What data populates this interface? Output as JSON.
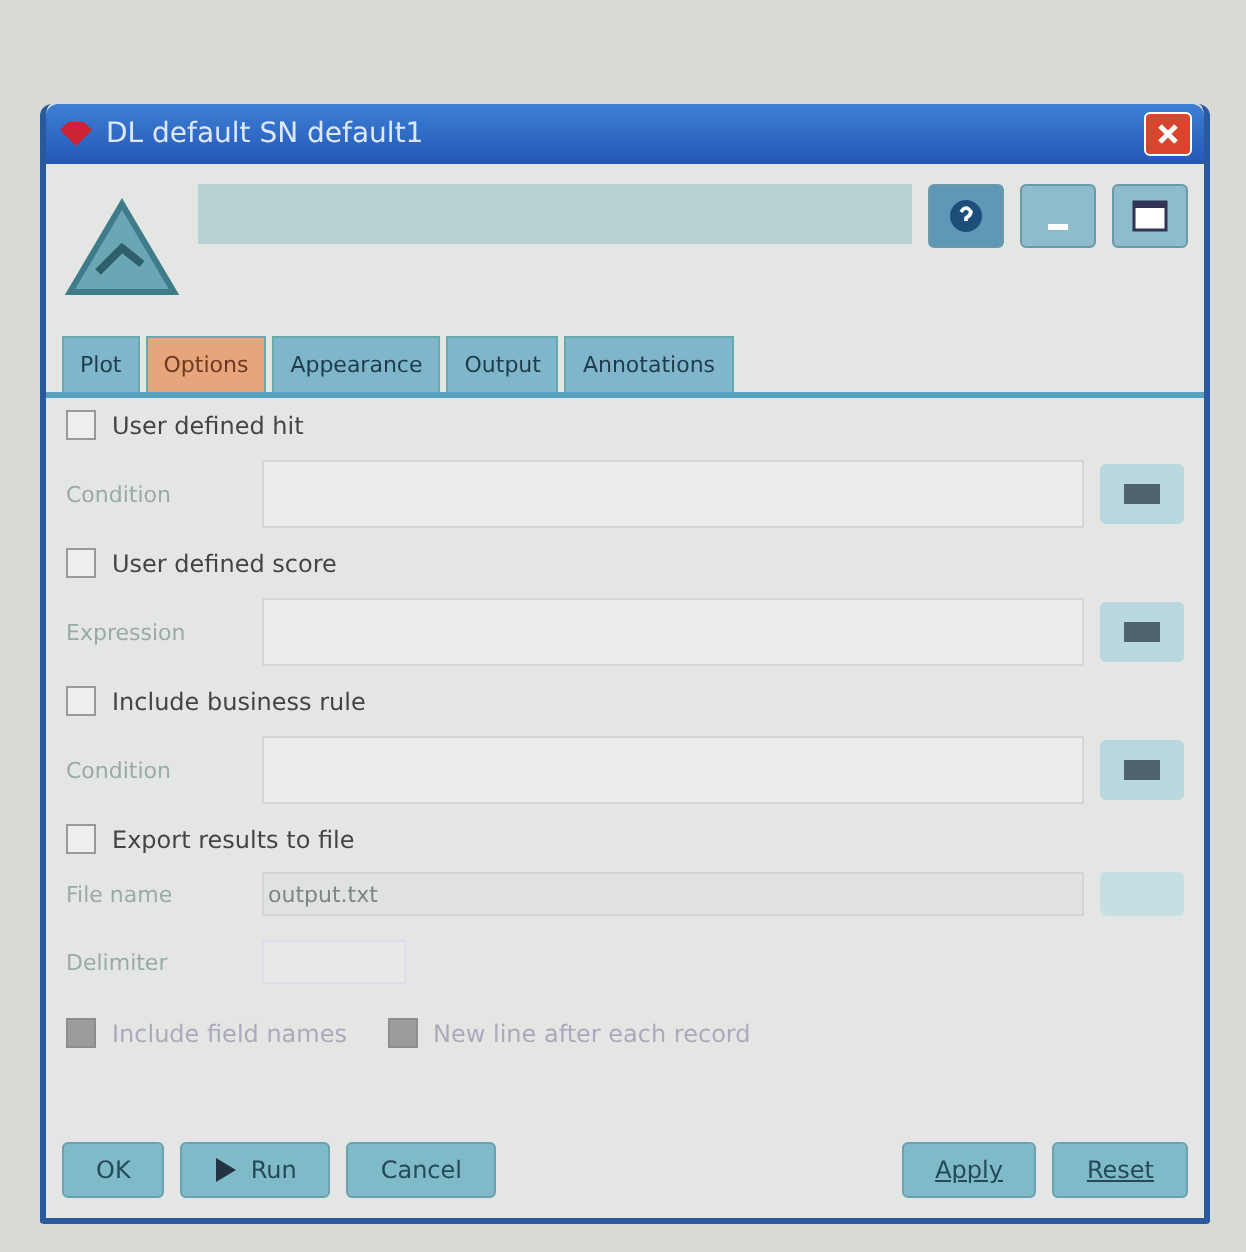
{
  "window": {
    "title": "DL default SN default1"
  },
  "tabs": [
    {
      "label": "Plot",
      "selected": false
    },
    {
      "label": "Options",
      "selected": true
    },
    {
      "label": "Appearance",
      "selected": false
    },
    {
      "label": "Output",
      "selected": false
    },
    {
      "label": "Annotations",
      "selected": false
    }
  ],
  "sections": [
    {
      "checkbox": {
        "label": "User defined hit",
        "checked": false
      },
      "field": {
        "label": "Condition"
      }
    },
    {
      "checkbox": {
        "label": "User defined score",
        "checked": false
      },
      "field": {
        "label": "Expression"
      }
    },
    {
      "checkbox": {
        "label": "Include business rule",
        "checked": false
      },
      "field": {
        "label": "Condition"
      }
    }
  ],
  "export": {
    "checkbox": {
      "label": "Export results to file",
      "checked": false
    },
    "file_name": {
      "label": "File name",
      "value": "output.txt",
      "disabled": true
    },
    "delimiter": {
      "label": "Delimiter"
    },
    "options": [
      {
        "label": "Include field names",
        "checked": true,
        "disabled": true
      },
      {
        "label": "New line after each record",
        "checked": true,
        "disabled": true
      }
    ]
  },
  "buttons_left": [
    {
      "label": "OK",
      "kind": "text"
    },
    {
      "label": "Run",
      "kind": "run"
    },
    {
      "label": "Cancel",
      "kind": "text"
    }
  ],
  "buttons_right": [
    {
      "label": "Apply"
    },
    {
      "label": "Reset"
    }
  ]
}
